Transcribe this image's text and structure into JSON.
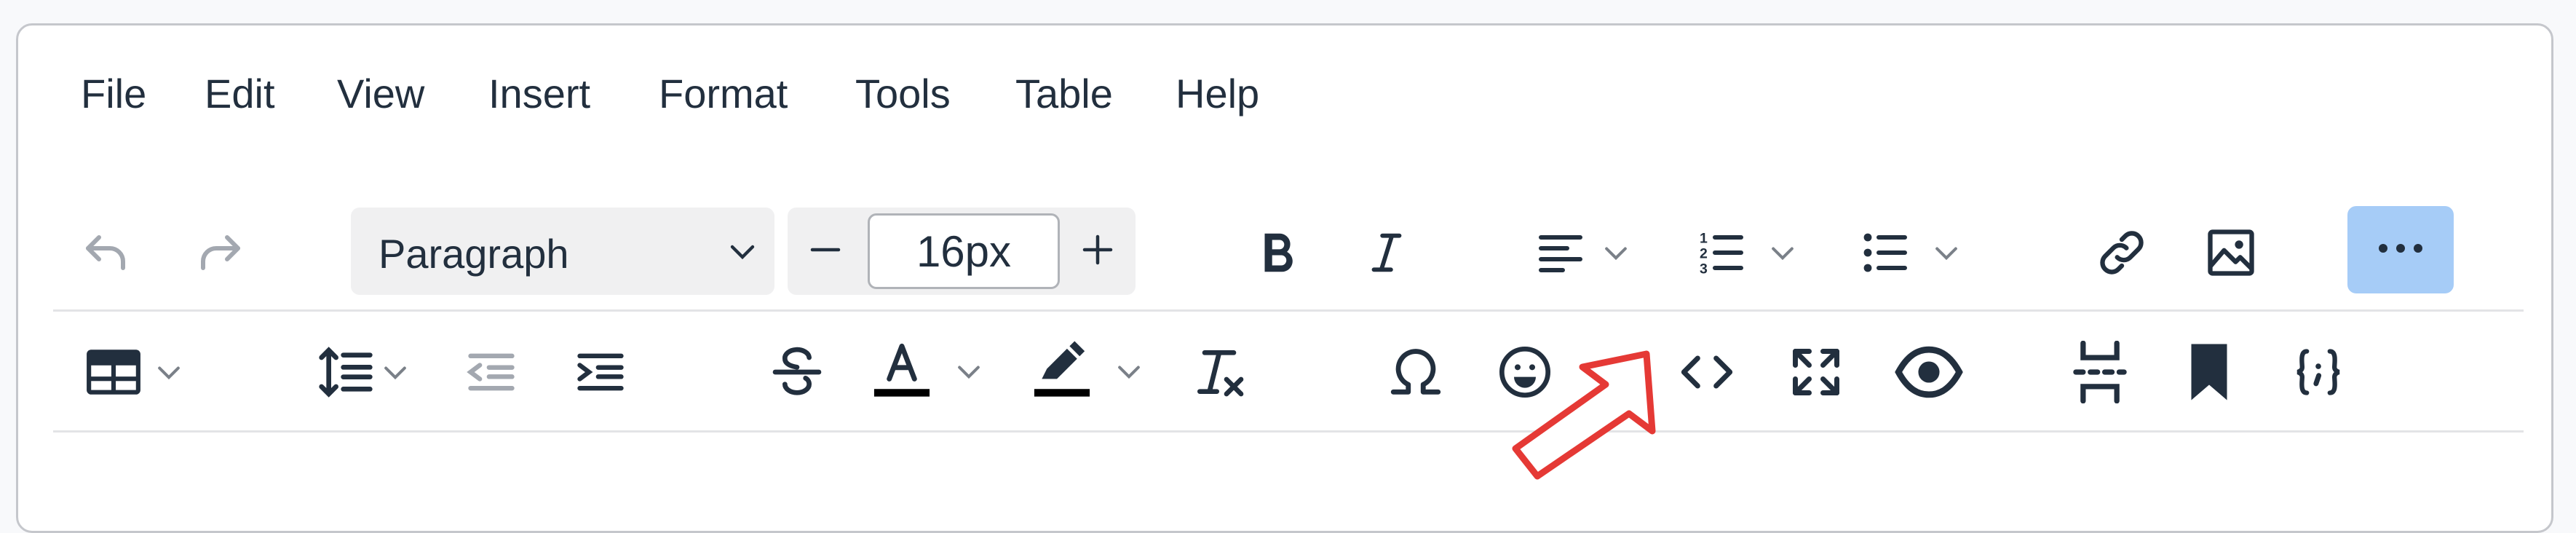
{
  "menubar": {
    "items": [
      "File",
      "Edit",
      "View",
      "Insert",
      "Format",
      "Tools",
      "Table",
      "Help"
    ]
  },
  "toolbar": {
    "block_format": "Paragraph",
    "font_size": "16px",
    "more_button_active": true
  },
  "icons": {
    "row1": [
      "undo-icon",
      "redo-icon",
      "bold-icon",
      "italic-icon",
      "align-left-icon",
      "numbered-list-icon",
      "bullet-list-icon",
      "link-icon",
      "image-icon",
      "more-icon"
    ],
    "row2": [
      "table-icon",
      "line-height-icon",
      "outdent-icon",
      "indent-icon",
      "strikethrough-icon",
      "text-color-icon",
      "highlight-icon",
      "clear-formatting-icon",
      "special-character-icon",
      "emoji-icon",
      "source-code-icon",
      "fullscreen-icon",
      "preview-icon",
      "page-break-icon",
      "bookmark-icon",
      "code-sample-icon"
    ]
  },
  "colors": {
    "text_color_bar": "#000000",
    "highlight_bar": "#000000",
    "active_button": "#a6ccf7",
    "annotation_arrow": "#e53935"
  }
}
